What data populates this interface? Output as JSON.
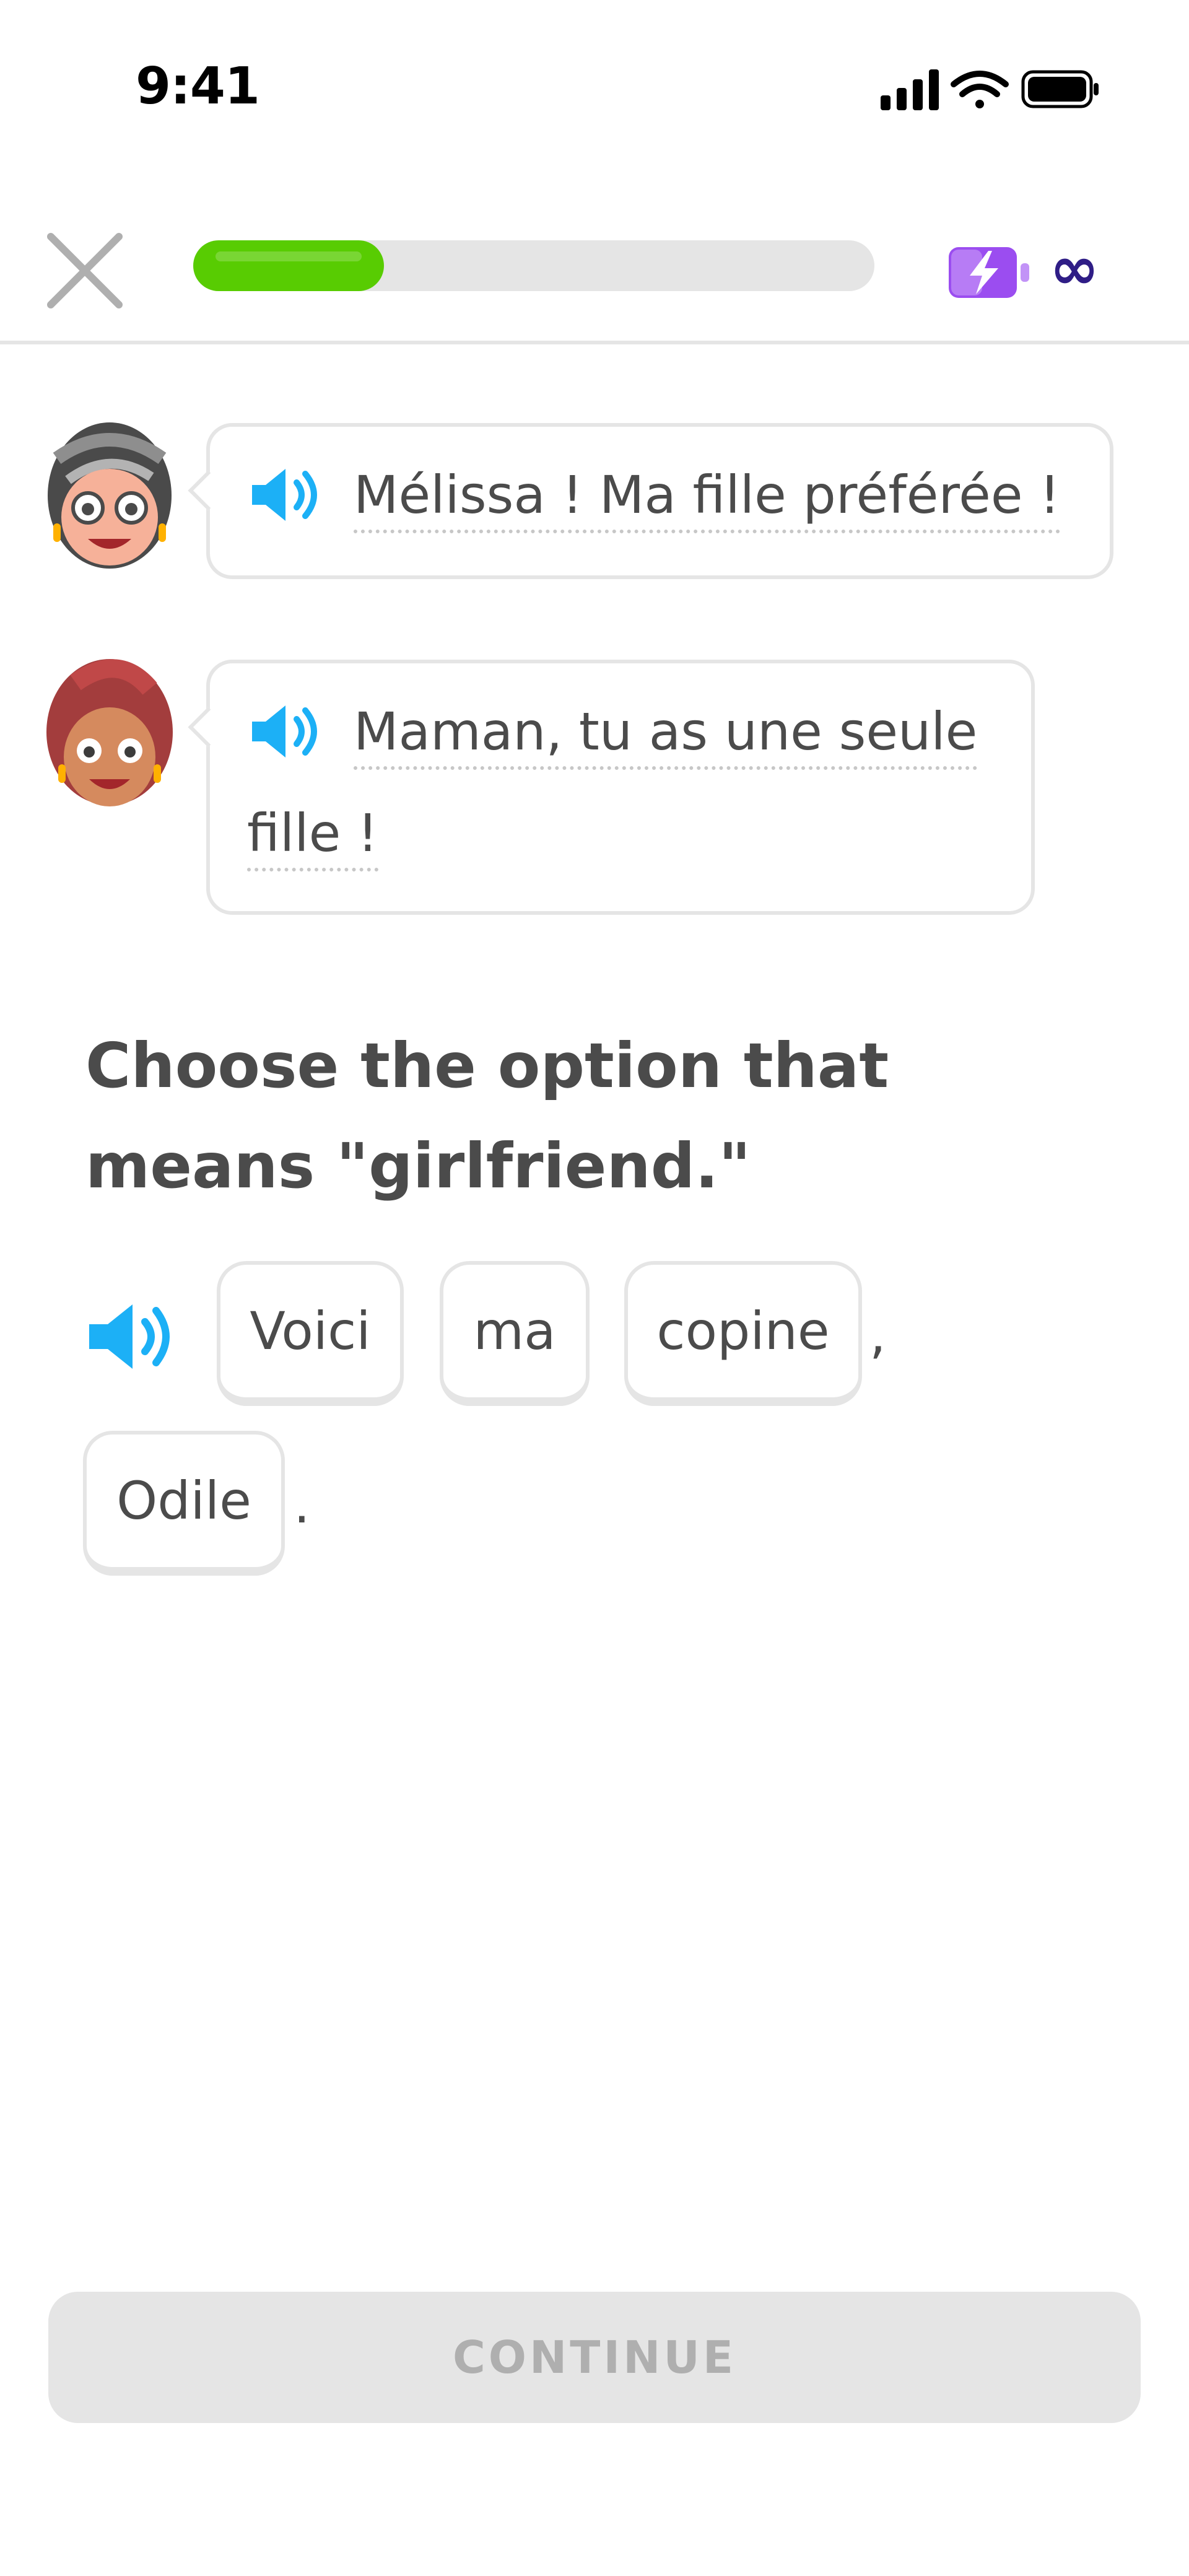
{
  "status_bar": {
    "time": "9:41"
  },
  "header": {
    "progress_fraction": 0.28,
    "hearts_label": "∞",
    "energy_color": "#9b4df0",
    "progress_color": "#58cc02"
  },
  "chat": [
    {
      "speaker": "grandmother-avatar",
      "text": "Mélissa ! Ma fille préférée !"
    },
    {
      "speaker": "woman-avatar",
      "line1": "Maman, tu as une seule",
      "line2": "fille !"
    }
  ],
  "challenge": {
    "prompt": "Choose the option that means \"girlfriend.\"",
    "words": [
      "Voici",
      "ma",
      "copine",
      "Odile"
    ],
    "punctuation": [
      ",",
      "."
    ]
  },
  "footer": {
    "continue_label": "CONTINUE"
  }
}
